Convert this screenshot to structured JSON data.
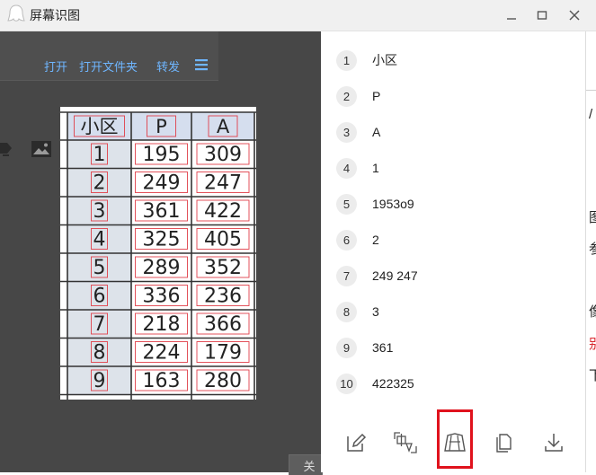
{
  "window": {
    "title": "屏幕识图"
  },
  "toolbar": {
    "open": "打开",
    "open_folder": "打开文件夹",
    "forward": "转发"
  },
  "captured_table": {
    "headers": [
      "小区",
      "P",
      "A"
    ],
    "rows": [
      [
        "1",
        "195",
        "309"
      ],
      [
        "2",
        "249",
        "247"
      ],
      [
        "3",
        "361",
        "422"
      ],
      [
        "4",
        "325",
        "405"
      ],
      [
        "5",
        "289",
        "352"
      ],
      [
        "6",
        "336",
        "236"
      ],
      [
        "7",
        "218",
        "366"
      ],
      [
        "8",
        "224",
        "179"
      ],
      [
        "9",
        "163",
        "280"
      ]
    ]
  },
  "partial_button": "关",
  "ocr_results": [
    {
      "num": "1",
      "text": "小区"
    },
    {
      "num": "2",
      "text": "P"
    },
    {
      "num": "3",
      "text": "A"
    },
    {
      "num": "4",
      "text": "1"
    },
    {
      "num": "5",
      "text": "1953o9"
    },
    {
      "num": "6",
      "text": "2"
    },
    {
      "num": "7",
      "text": "249 247"
    },
    {
      "num": "8",
      "text": "3"
    },
    {
      "num": "9",
      "text": "361"
    },
    {
      "num": "10",
      "text": "422325"
    }
  ],
  "bottom_actions": [
    {
      "name": "edit-button",
      "icon": "edit-icon"
    },
    {
      "name": "translate-button",
      "icon": "translate-icon"
    },
    {
      "name": "table-convert-button",
      "icon": "table-convert-icon"
    },
    {
      "name": "copy-button",
      "icon": "copy-icon"
    },
    {
      "name": "download-button",
      "icon": "download-icon"
    }
  ],
  "right_strip_chars": [
    "/",
    "图",
    "参",
    "像",
    "别",
    "下"
  ],
  "colors": {
    "link": "#6fb6ff",
    "highlight": "#e0121d",
    "table_header": "#d5deee",
    "table_index": "#dde3ea"
  }
}
